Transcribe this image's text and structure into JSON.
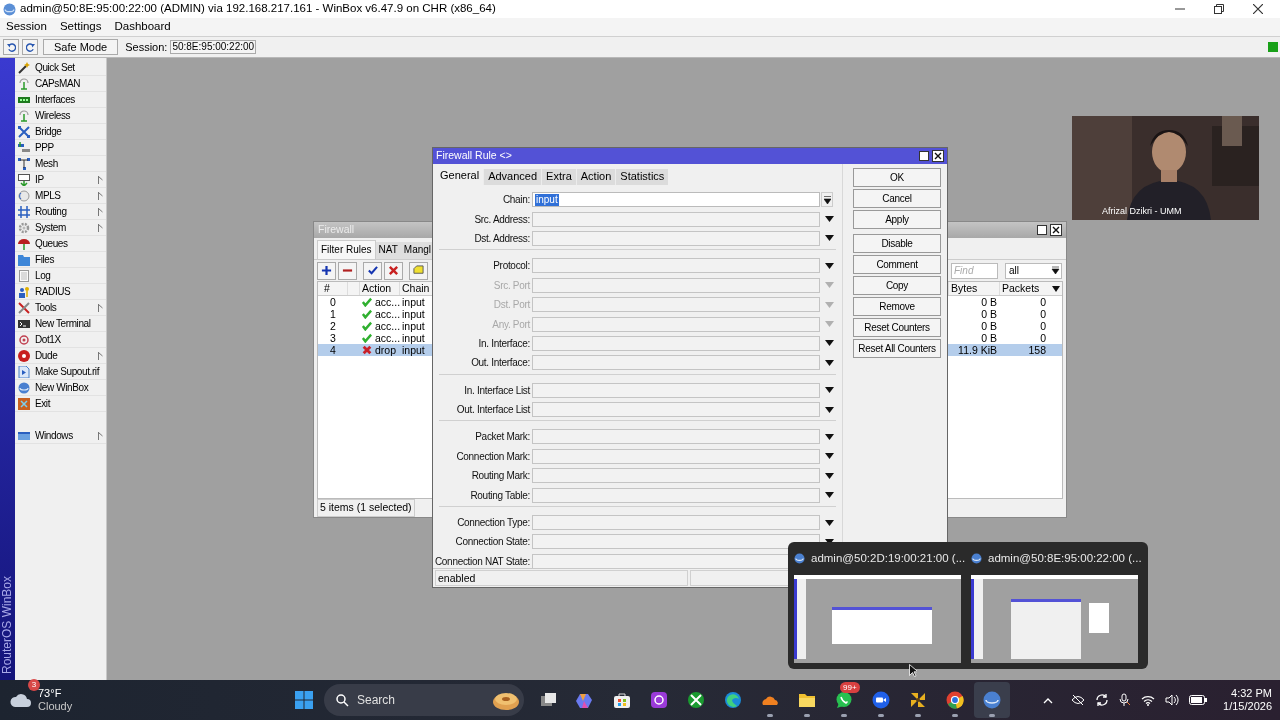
{
  "window": {
    "title": "admin@50:8E:95:00:22:00 (ADMIN) via 192.168.217.161 - WinBox v6.47.9 on CHR (x86_64)"
  },
  "menu": [
    "Session",
    "Settings",
    "Dashboard"
  ],
  "toolbar": {
    "safe_mode": "Safe Mode",
    "session_label": "Session:",
    "session_value": "50:8E:95:00:22:00"
  },
  "side_banner": "RouterOS WinBox",
  "sidebar": {
    "items": [
      {
        "label": "Quick Set",
        "submenu": false
      },
      {
        "label": "CAPsMAN",
        "submenu": false
      },
      {
        "label": "Interfaces",
        "submenu": false
      },
      {
        "label": "Wireless",
        "submenu": false
      },
      {
        "label": "Bridge",
        "submenu": false
      },
      {
        "label": "PPP",
        "submenu": false
      },
      {
        "label": "Mesh",
        "submenu": false
      },
      {
        "label": "IP",
        "submenu": true
      },
      {
        "label": "MPLS",
        "submenu": true
      },
      {
        "label": "Routing",
        "submenu": true
      },
      {
        "label": "System",
        "submenu": true
      },
      {
        "label": "Queues",
        "submenu": false
      },
      {
        "label": "Files",
        "submenu": false
      },
      {
        "label": "Log",
        "submenu": false
      },
      {
        "label": "RADIUS",
        "submenu": false
      },
      {
        "label": "Tools",
        "submenu": true
      },
      {
        "label": "New Terminal",
        "submenu": false
      },
      {
        "label": "Dot1X",
        "submenu": false
      },
      {
        "label": "Dude",
        "submenu": true
      },
      {
        "label": "Make Supout.rif",
        "submenu": false
      },
      {
        "label": "New WinBox",
        "submenu": false
      },
      {
        "label": "Exit",
        "submenu": false
      }
    ],
    "windows_item": {
      "label": "Windows",
      "submenu": true
    }
  },
  "firewall": {
    "title": "Firewall",
    "tabs": [
      {
        "label": "Filter Rules",
        "selected": true
      },
      {
        "label": "NAT",
        "selected": false
      },
      {
        "label": "Mangl",
        "selected": false
      }
    ],
    "find_placeholder": "Find",
    "filter": "all",
    "columns": {
      "number": "#",
      "action": "Action",
      "chain": "Chain",
      "bytes": "Bytes",
      "packets": "Packets"
    },
    "rows": [
      {
        "index": "0",
        "kind": "accept",
        "action": "acc...",
        "chain": "input",
        "bytes": "0 B",
        "packets": "0",
        "selected": false
      },
      {
        "index": "1",
        "kind": "accept",
        "action": "acc...",
        "chain": "input",
        "bytes": "0 B",
        "packets": "0",
        "selected": false
      },
      {
        "index": "2",
        "kind": "accept",
        "action": "acc...",
        "chain": "input",
        "bytes": "0 B",
        "packets": "0",
        "selected": false
      },
      {
        "index": "3",
        "kind": "accept",
        "action": "acc...",
        "chain": "input",
        "bytes": "0 B",
        "packets": "0",
        "selected": false
      },
      {
        "index": "4",
        "kind": "drop",
        "action": "drop",
        "chain": "input",
        "bytes": "11.9 KiB",
        "packets": "158",
        "selected": true
      }
    ],
    "status": "5 items (1 selected)"
  },
  "rule_dialog": {
    "title": "Firewall Rule <>",
    "tabs": [
      {
        "label": "General",
        "selected": true
      },
      {
        "label": "Advanced",
        "selected": false
      },
      {
        "label": "Extra",
        "selected": false
      },
      {
        "label": "Action",
        "selected": false
      },
      {
        "label": "Statistics",
        "selected": false
      }
    ],
    "sections": [
      [
        {
          "label": "Chain:",
          "kind": "combo",
          "value": "input",
          "highlighted": true,
          "disabled": false
        },
        {
          "label": "Src. Address:",
          "kind": "select",
          "disabled": false
        },
        {
          "label": "Dst. Address:",
          "kind": "select",
          "disabled": false
        }
      ],
      [
        {
          "label": "Protocol:",
          "kind": "select",
          "disabled": false
        },
        {
          "label": "Src. Port",
          "kind": "select",
          "disabled": true
        },
        {
          "label": "Dst. Port",
          "kind": "select",
          "disabled": true
        },
        {
          "label": "Any. Port",
          "kind": "select",
          "disabled": true
        },
        {
          "label": "In. Interface:",
          "kind": "select",
          "disabled": false
        },
        {
          "label": "Out. Interface:",
          "kind": "select",
          "disabled": false
        }
      ],
      [
        {
          "label": "In. Interface List",
          "kind": "select",
          "disabled": false
        },
        {
          "label": "Out. Interface List",
          "kind": "select",
          "disabled": false
        }
      ],
      [
        {
          "label": "Packet Mark:",
          "kind": "select",
          "disabled": false
        },
        {
          "label": "Connection Mark:",
          "kind": "select",
          "disabled": false
        },
        {
          "label": "Routing Mark:",
          "kind": "select",
          "disabled": false
        },
        {
          "label": "Routing Table:",
          "kind": "select",
          "disabled": false
        }
      ],
      [
        {
          "label": "Connection Type:",
          "kind": "select",
          "disabled": false
        },
        {
          "label": "Connection State:",
          "kind": "select",
          "disabled": false
        },
        {
          "label": "Connection NAT State:",
          "kind": "select",
          "disabled": false
        }
      ]
    ],
    "buttons": [
      [
        "OK",
        "Cancel",
        "Apply"
      ],
      [
        "Disable",
        "Comment",
        "Copy",
        "Remove",
        "Reset Counters",
        "Reset All Counters"
      ]
    ],
    "status": "enabled"
  },
  "video_tile": {
    "kind": "picture",
    "name": "Afrizal Dzikri - UMM"
  },
  "thumbnails": [
    {
      "title": "admin@50:2D:19:00:21:00 (..."
    },
    {
      "title": "admin@50:8E:95:00:22:00 (..."
    }
  ],
  "taskbar": {
    "weather": {
      "badge": "3",
      "temperature": "73°F",
      "condition": "Cloudy"
    },
    "search": "Search",
    "apps": [
      {
        "kind": "taskview",
        "running": false
      },
      {
        "kind": "copilot",
        "running": false
      },
      {
        "kind": "store",
        "running": false
      },
      {
        "kind": "purple",
        "running": false
      },
      {
        "kind": "xbox",
        "running": false
      },
      {
        "kind": "edge",
        "running": false
      },
      {
        "kind": "cloud",
        "running": true
      },
      {
        "kind": "folder",
        "running": true
      },
      {
        "kind": "chat",
        "running": true,
        "badge": "99+"
      },
      {
        "kind": "zoom",
        "running": true
      },
      {
        "kind": "tools",
        "running": true
      },
      {
        "kind": "chrome",
        "running": true
      },
      {
        "kind": "winbox",
        "running": true
      }
    ],
    "clock": {
      "time": "4:32 PM",
      "date": "1/15/2026"
    }
  }
}
